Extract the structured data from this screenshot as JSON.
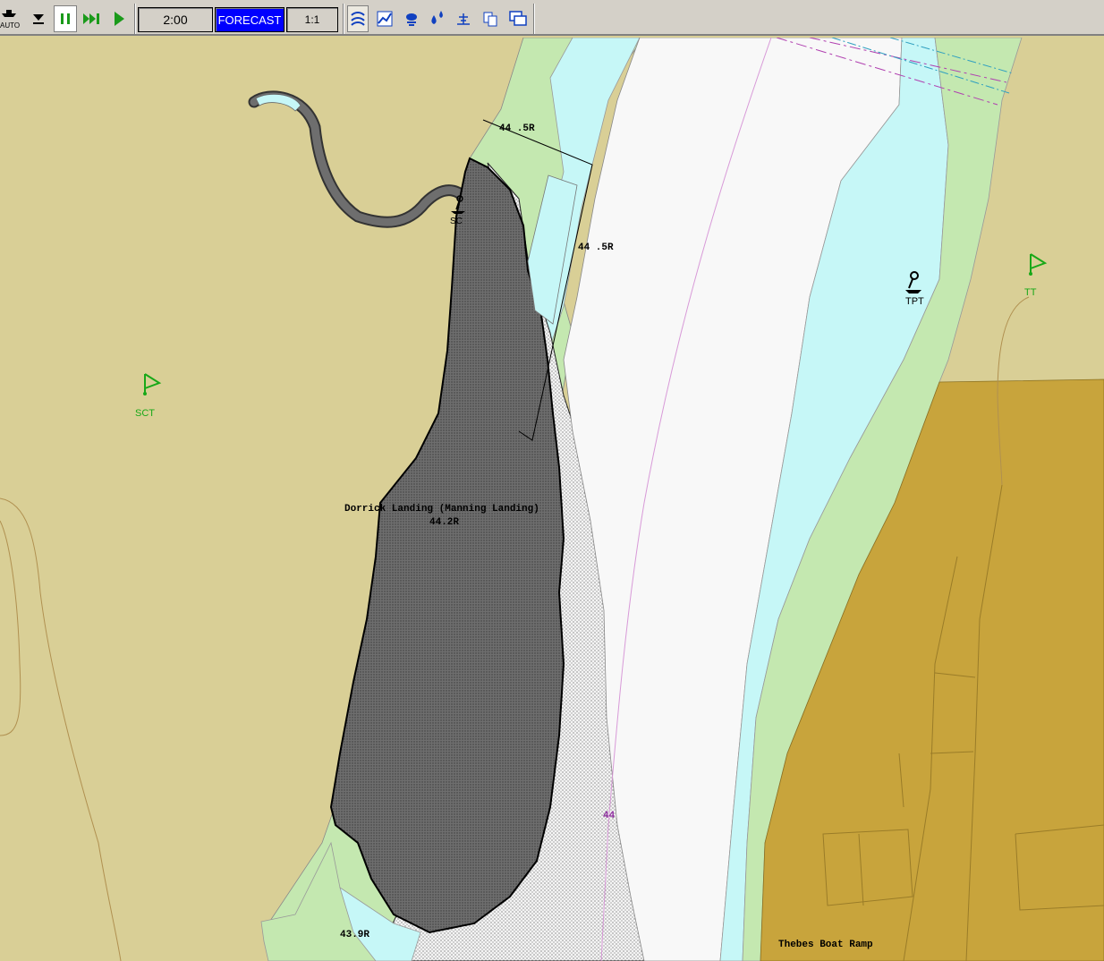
{
  "toolbar": {
    "auto_label": "AUTO",
    "time_value": "2:00",
    "forecast_label": "FORECAST",
    "scale_value": "1:1"
  },
  "map": {
    "soundings": {
      "s1": "44 .5R",
      "s2": "44 .5R",
      "s3": "44.2R",
      "s4": "43.9R",
      "s5": "44"
    },
    "place_names": {
      "landing": "Dorrick Landing (Manning Landing)",
      "boat_ramp": "Thebes Boat Ramp"
    },
    "symbols": {
      "flag_sct": "SCT",
      "flag_tt": "TT",
      "tpt": "TPT",
      "sc": "SC"
    },
    "colors": {
      "land": "#d9cf96",
      "built_area": "#c8a43c",
      "shallow": "#c6f7f7",
      "intertidal": "#c4e8b0",
      "deep": "#f8f8f8",
      "flag": "#18a818"
    }
  }
}
